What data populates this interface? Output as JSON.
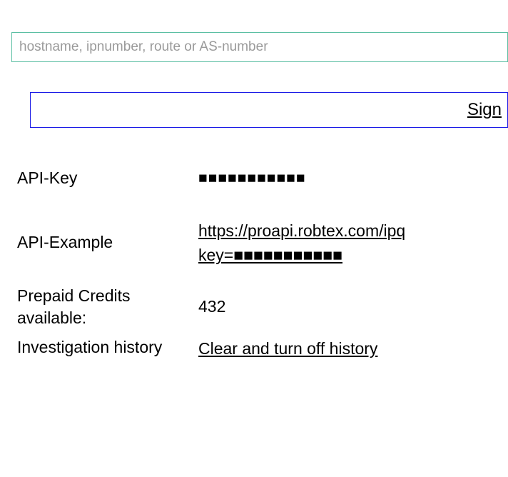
{
  "search": {
    "placeholder": "hostname, ipnumber, route or AS-number",
    "value": ""
  },
  "sign": {
    "label": "Sign"
  },
  "table": {
    "apiKey": {
      "label": "API-Key",
      "value": "■■■■■■■■■■■"
    },
    "apiExample": {
      "label": "API-Example",
      "link_line1": "https://proapi.robtex.com/ipq",
      "link_line2": "key=■■■■■■■■■■■"
    },
    "credits": {
      "label": "Prepaid Credits available:",
      "value": "432"
    },
    "history": {
      "label": "Investigation history",
      "action": "Clear and turn off history"
    }
  }
}
